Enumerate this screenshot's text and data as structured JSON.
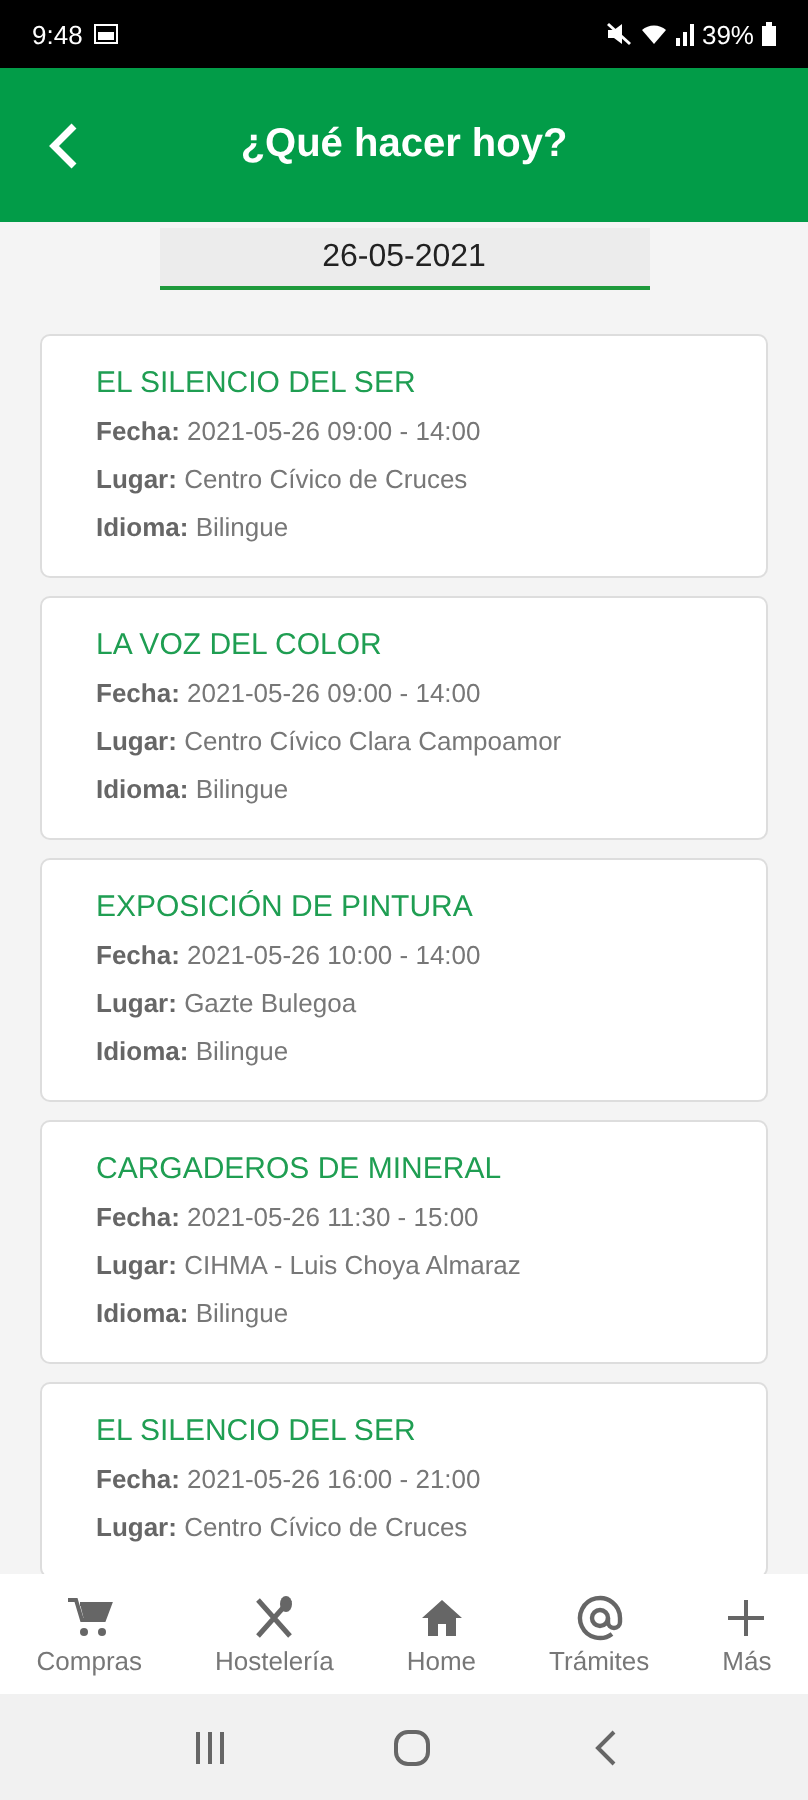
{
  "status_bar": {
    "time": "9:48",
    "battery": "39%"
  },
  "header": {
    "title": "¿Qué hacer hoy?"
  },
  "date_field": {
    "value": "26-05-2021"
  },
  "events": [
    {
      "title": "EL SILENCIO DEL SER",
      "lines": [
        "**Fecha:** 2021-05-26 09:00 - 14:00",
        "**Lugar:** Centro Cívico de Cruces",
        "**Idioma:** Bilingue"
      ]
    },
    {
      "title": "LA VOZ DEL COLOR",
      "lines": [
        "**Fecha:** 2021-05-26 09:00 - 14:00",
        "**Lugar:** Centro Cívico Clara Campoamor",
        "**Idioma:** Bilingue"
      ]
    },
    {
      "title": "EXPOSICIÓN DE PINTURA",
      "lines": [
        "**Fecha:** 2021-05-26 10:00 - 14:00",
        "**Lugar:** Gazte Bulegoa",
        "**Idioma:** Bilingue"
      ]
    },
    {
      "title": "CARGADEROS DE MINERAL",
      "lines": [
        "**Fecha:** 2021-05-26 11:30 - 15:00",
        "**Lugar:** CIHMA - Luis Choya Almaraz",
        "**Idioma:** Bilingue"
      ]
    },
    {
      "title": "EL SILENCIO DEL SER",
      "lines": [
        "**Fecha:** 2021-05-26 16:00 - 21:00",
        "**Lugar:** Centro Cívico de Cruces"
      ]
    }
  ],
  "bottom_nav": [
    {
      "kind": "cart",
      "label": "Compras"
    },
    {
      "kind": "cutlery",
      "label": "Hostelería"
    },
    {
      "kind": "home",
      "label": "Home"
    },
    {
      "kind": "at",
      "label": "Trámites"
    },
    {
      "kind": "plus",
      "label": "Más"
    }
  ]
}
